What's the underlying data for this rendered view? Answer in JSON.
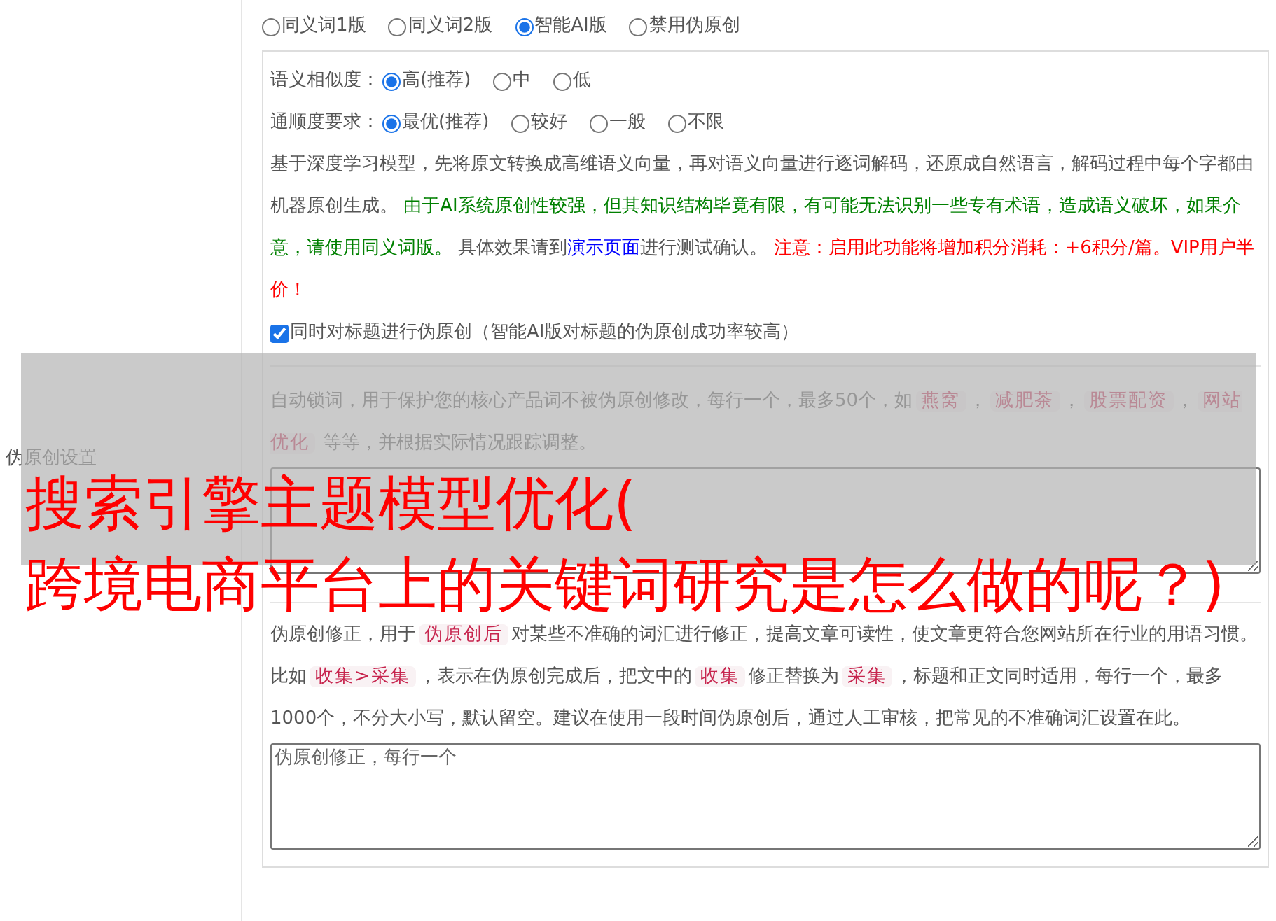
{
  "mode_options": [
    {
      "label": "同义词1版",
      "selected": false
    },
    {
      "label": "同义词2版",
      "selected": false
    },
    {
      "label": "智能AI版",
      "selected": true
    },
    {
      "label": "禁用伪原创",
      "selected": false
    }
  ],
  "similarity": {
    "label": "语义相似度：",
    "options": [
      {
        "label": "高(推荐)",
        "selected": true
      },
      {
        "label": "中",
        "selected": false
      },
      {
        "label": "低",
        "selected": false
      }
    ]
  },
  "fluency": {
    "label": "通顺度要求：",
    "options": [
      {
        "label": "最优(推荐)",
        "selected": true
      },
      {
        "label": "较好",
        "selected": false
      },
      {
        "label": "一般",
        "selected": false
      },
      {
        "label": "不限",
        "selected": false
      }
    ]
  },
  "ai_description": [
    {
      "kind": "plain",
      "text": "基于深度学习模型，先将原文转换成高维语义向量，再对语义向量进行逐词解码，还原成自然语言，解码过程中每个字都由机器原创生成。 "
    },
    {
      "kind": "note",
      "text": "由于AI系统原创性较强，但其知识结构毕竟有限，有可能无法识别一些专有术语，造成语义破坏，如果介意，请使用同义词版。"
    },
    {
      "kind": "plain",
      "text": " 具体效果请到"
    },
    {
      "kind": "link",
      "text": "演示页面"
    },
    {
      "kind": "plain",
      "text": "进行测试确认。 "
    },
    {
      "kind": "warning",
      "text": "注意：启用此功能将增加积分消耗：+6积分/篇。VIP用户半价！"
    }
  ],
  "title_checkbox": {
    "label": "同时对标题进行伪原创（智能AI版对标题的伪原创成功率较高）",
    "checked": true
  },
  "section_label": "伪原创设置",
  "lock_words": {
    "description": [
      {
        "kind": "plain",
        "text": "自动锁词，用于保护您的核心产品词不被伪原创修改，每行一个，最多50个，如"
      },
      {
        "kind": "chip",
        "text": "燕窝"
      },
      {
        "kind": "plain",
        "text": "，"
      },
      {
        "kind": "chip",
        "text": "减肥茶"
      },
      {
        "kind": "plain",
        "text": "，"
      },
      {
        "kind": "chip",
        "text": "股票配资"
      },
      {
        "kind": "plain",
        "text": "，"
      },
      {
        "kind": "chip",
        "text": "网站优化"
      },
      {
        "kind": "plain",
        "text": " 等等，并根据实际情况跟踪调整。"
      }
    ]
  },
  "correction": {
    "description": [
      {
        "kind": "plain",
        "text": "伪原创修正，用于"
      },
      {
        "kind": "chip",
        "text": "伪原创后"
      },
      {
        "kind": "plain",
        "text": "对某些不准确的词汇进行修正，提高文章可读性，使文章更符合您网站所在行业的用语习惯。比如"
      },
      {
        "kind": "chip",
        "text": "收集>采集"
      },
      {
        "kind": "plain",
        "text": "，表示在伪原创完成后，把文中的"
      },
      {
        "kind": "chip",
        "text": "收集"
      },
      {
        "kind": "plain",
        "text": "修正替换为"
      },
      {
        "kind": "chip",
        "text": "采集"
      },
      {
        "kind": "plain",
        "text": "，标题和正文同时适用，每行一个，最多1000个，不分大小写，默认留空。建议在使用一段时间伪原创后，通过人工审核，把常见的不准确词汇设置在此。"
      }
    ],
    "placeholder": "伪原创修正，每行一个"
  },
  "overlay": {
    "lines": [
      "搜索引擎主题模型优化(",
      "跨境电商平台上的关键词研究是怎么做的呢？)"
    ]
  }
}
